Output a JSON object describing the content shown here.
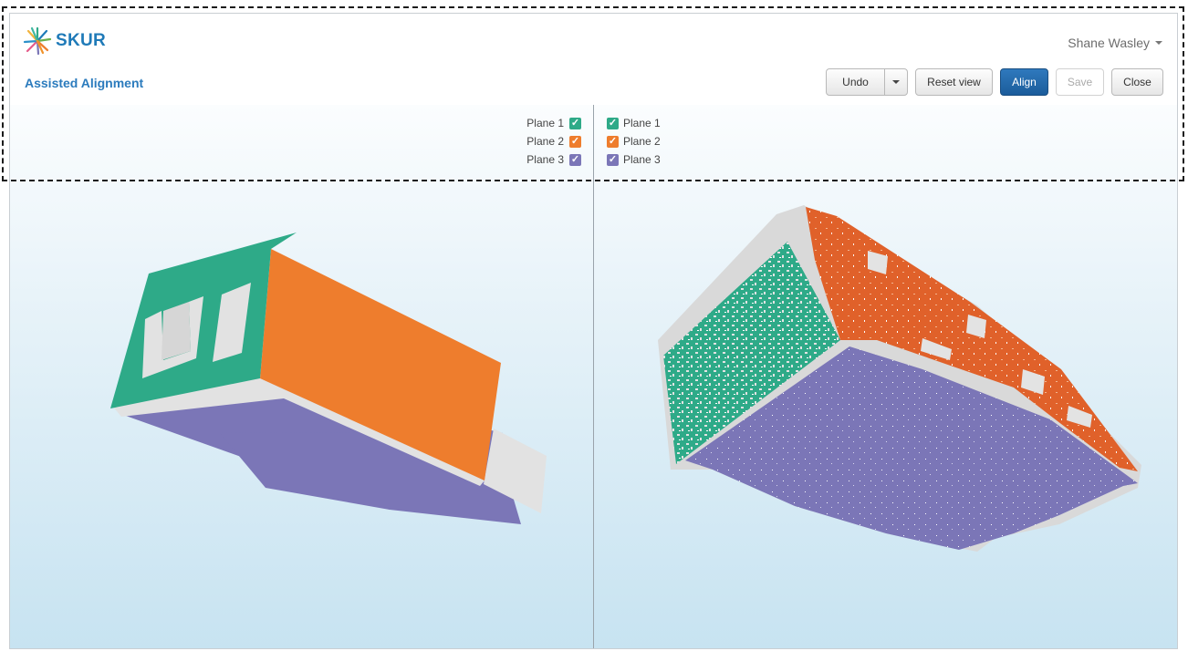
{
  "app": {
    "brand": "SKUR",
    "user": "Shane Wasley",
    "page_title": "Assisted Alignment"
  },
  "toolbar": {
    "undo_label": "Undo",
    "reset_label": "Reset view",
    "align_label": "Align",
    "save_label": "Save",
    "close_label": "Close"
  },
  "legend": {
    "left": [
      {
        "label": "Plane 1",
        "color": "#2eaa88",
        "checked": true
      },
      {
        "label": "Plane 2",
        "color": "#ee7d2d",
        "checked": true
      },
      {
        "label": "Plane 3",
        "color": "#7b76b7",
        "checked": true
      }
    ],
    "right": [
      {
        "label": "Plane 1",
        "color": "#2eaa88",
        "checked": true
      },
      {
        "label": "Plane 2",
        "color": "#ee7d2d",
        "checked": true
      },
      {
        "label": "Plane 3",
        "color": "#7b76b7",
        "checked": true
      }
    ]
  },
  "colors": {
    "plane1": "#2eaa88",
    "plane2": "#ee7d2d",
    "plane3": "#7b76b7",
    "structure": "#e2e2e2",
    "accent": "#1f7ab8"
  }
}
